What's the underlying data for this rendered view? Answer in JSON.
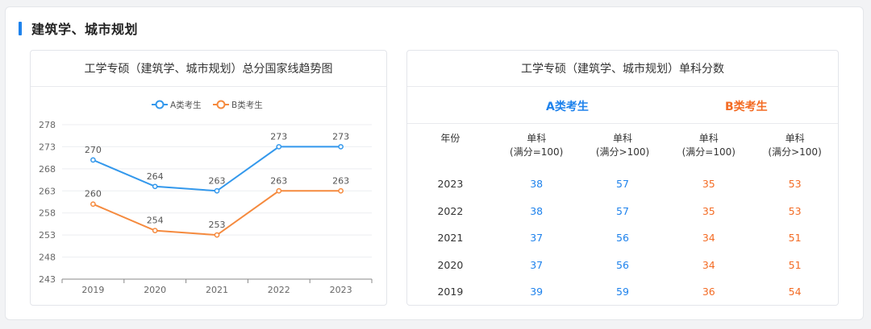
{
  "section": {
    "title": "建筑学、城市规划"
  },
  "left_card": {
    "title": "工学专硕（建筑学、城市规划）总分国家线趋势图"
  },
  "right_card": {
    "title": "工学专硕（建筑学、城市规划）单科分数",
    "group_a": "A类考生",
    "group_b": "B类考生",
    "headers": [
      "年份",
      [
        "单科",
        "(满分=100)"
      ],
      [
        "单科",
        "(满分>100)"
      ],
      [
        "单科",
        "(满分=100)"
      ],
      [
        "单科",
        "(满分>100)"
      ]
    ],
    "rows": [
      [
        "2023",
        "38",
        "57",
        "35",
        "53"
      ],
      [
        "2022",
        "38",
        "57",
        "35",
        "53"
      ],
      [
        "2021",
        "37",
        "56",
        "34",
        "51"
      ],
      [
        "2020",
        "37",
        "56",
        "34",
        "51"
      ],
      [
        "2019",
        "39",
        "59",
        "36",
        "54"
      ]
    ]
  },
  "colors": {
    "a": "#3398ec",
    "b": "#f58a3e",
    "accent": "#1e82ec",
    "b_text": "#f36b24"
  },
  "chart_data": {
    "type": "line",
    "title": "工学专硕（建筑学、城市规划）总分国家线趋势图",
    "categories": [
      "2019",
      "2020",
      "2021",
      "2022",
      "2023"
    ],
    "series": [
      {
        "name": "A类考生",
        "values": [
          270,
          264,
          263,
          273,
          273
        ]
      },
      {
        "name": "B类考生",
        "values": [
          260,
          254,
          253,
          263,
          263
        ]
      }
    ],
    "ylim": [
      243,
      278
    ],
    "yticks": [
      "278",
      "273",
      "268",
      "263",
      "258",
      "253",
      "248",
      "243"
    ],
    "xlabel": "",
    "ylabel": "",
    "grid": true,
    "legend": "top-center"
  }
}
